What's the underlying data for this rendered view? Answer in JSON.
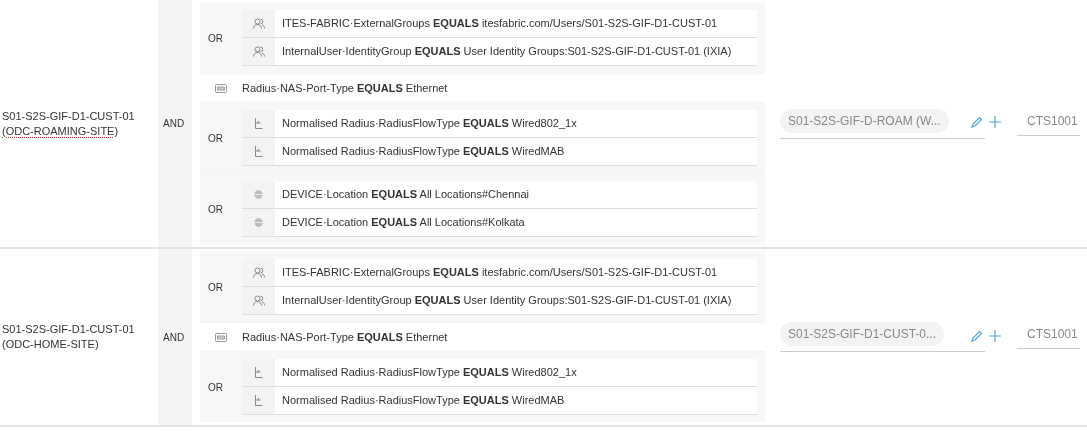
{
  "rules": [
    {
      "name_lines": [
        "S01-S2S-GIF-D1-CUST-01",
        "(ODC-ROAMING-SITE)"
      ],
      "spellcheck_flag": true,
      "operator": "AND",
      "conditions": [
        {
          "kind": "group",
          "operator": "OR",
          "items": [
            {
              "kind": "identity",
              "text": "ITES-FABRIC·ExternalGroups **EQUALS** itesfabric.com/Users/S01-S2S-GIF-D1-CUST-01"
            },
            {
              "kind": "identity",
              "text": "InternalUser·IdentityGroup **EQUALS** User Identity Groups:S01-S2S-GIF-D1-CUST-01 (IXIA)"
            }
          ]
        },
        {
          "kind": "single",
          "item": {
            "kind": "port",
            "text": "Radius·NAS-Port-Type **EQUALS** Ethernet"
          }
        },
        {
          "kind": "group",
          "operator": "OR",
          "items": [
            {
              "kind": "flow",
              "text": "Normalised Radius·RadiusFlowType **EQUALS** Wired802_1x"
            },
            {
              "kind": "flow",
              "text": "Normalised Radius·RadiusFlowType **EQUALS** WiredMAB"
            }
          ]
        },
        {
          "kind": "group",
          "operator": "OR",
          "items": [
            {
              "kind": "location",
              "text": "DEVICE·Location **EQUALS** All Locations#Chennai"
            },
            {
              "kind": "location",
              "text": "DEVICE·Location **EQUALS** All Locations#Kolkata"
            }
          ]
        }
      ],
      "profile": "S01-S2S-GIF-D-ROAM (W...",
      "sgt": "CTS1001"
    },
    {
      "name_lines": [
        "S01-S2S-GIF-D1-CUST-01",
        "(ODC-HOME-SITE)"
      ],
      "spellcheck_flag": false,
      "operator": "AND",
      "conditions": [
        {
          "kind": "group",
          "operator": "OR",
          "items": [
            {
              "kind": "identity",
              "text": "ITES-FABRIC·ExternalGroups **EQUALS** itesfabric.com/Users/S01-S2S-GIF-D1-CUST-01"
            },
            {
              "kind": "identity",
              "text": "InternalUser·IdentityGroup **EQUALS** User Identity Groups:S01-S2S-GIF-D1-CUST-01 (IXIA)"
            }
          ]
        },
        {
          "kind": "single",
          "item": {
            "kind": "port",
            "text": "Radius·NAS-Port-Type **EQUALS** Ethernet"
          }
        },
        {
          "kind": "group",
          "operator": "OR",
          "items": [
            {
              "kind": "flow",
              "text": "Normalised Radius·RadiusFlowType **EQUALS** Wired802_1x"
            },
            {
              "kind": "flow",
              "text": "Normalised Radius·RadiusFlowType **EQUALS** WiredMAB"
            }
          ]
        }
      ],
      "profile": "S01-S2S-GIF-D1-CUST-0...",
      "sgt": "CTS1001"
    }
  ]
}
